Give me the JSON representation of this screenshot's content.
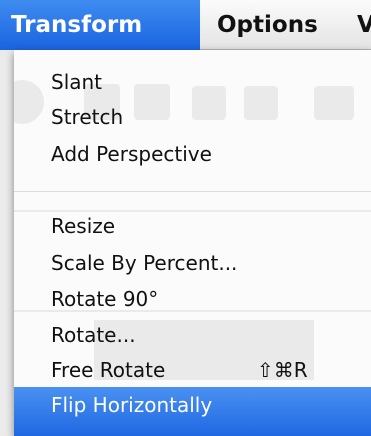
{
  "menubar": {
    "items": [
      {
        "label": "Transform",
        "active": true
      },
      {
        "label": "Options",
        "active": false
      },
      {
        "label": "V",
        "active": false
      }
    ]
  },
  "transform_menu": {
    "items": [
      {
        "label": "Slant",
        "shortcut": ""
      },
      {
        "label": "Stretch",
        "shortcut": ""
      },
      {
        "label": "Add Perspective",
        "shortcut": ""
      },
      {
        "label": "Resize",
        "shortcut": ""
      },
      {
        "label": "Scale By Percent...",
        "shortcut": ""
      },
      {
        "label": "Rotate 90°",
        "shortcut": ""
      },
      {
        "label": "Rotate...",
        "shortcut": ""
      },
      {
        "label": "Free Rotate",
        "shortcut": "⇧⌘R"
      },
      {
        "label": "Flip Horizontally",
        "shortcut": "",
        "highlighted": true
      }
    ]
  },
  "colors": {
    "highlight": "#2a72e8",
    "menu_background": "#fbfbfb",
    "menubar_background": "#f0f0f0"
  }
}
